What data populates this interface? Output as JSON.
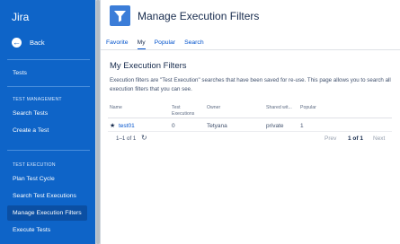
{
  "sidebar": {
    "app_title": "Jira",
    "back_label": "Back",
    "project_link": "Tests",
    "sections": [
      {
        "heading": "TEST MANAGEMENT",
        "items": [
          "Search Tests",
          "Create a Test"
        ]
      },
      {
        "heading": "TEST EXECUTION",
        "items": [
          "Plan Test Cycle",
          "Search Test Executions",
          "Manage Execution Filters",
          "Execute Tests"
        ]
      }
    ],
    "active_item": "Manage Execution Filters"
  },
  "page": {
    "title": "Manage Execution Filters",
    "tabs": [
      "Favorite",
      "My",
      "Popular",
      "Search"
    ],
    "active_tab": "My",
    "section_title": "My Execution Filters",
    "description": "Execution filters are \"Test Execution\" searches that have been saved for re-use. This page allows you to search all execution filters that you can see."
  },
  "table": {
    "columns": [
      "Name",
      "Test Executions",
      "Owner",
      "Shared wit...",
      "Popular"
    ],
    "rows": [
      {
        "name": "test01",
        "test_executions": "0",
        "owner": "Tetyana",
        "shared_with": "private",
        "popular": "1",
        "favorite": true
      }
    ]
  },
  "pagination": {
    "count_text": "1–1 of 1",
    "prev_label": "Prev",
    "page_text": "1 of 1",
    "next_label": "Next"
  },
  "colors": {
    "sidebar": "#0e64c8",
    "active_item": "#0b4fa3",
    "link": "#0052cc",
    "text": "#172b4d"
  }
}
